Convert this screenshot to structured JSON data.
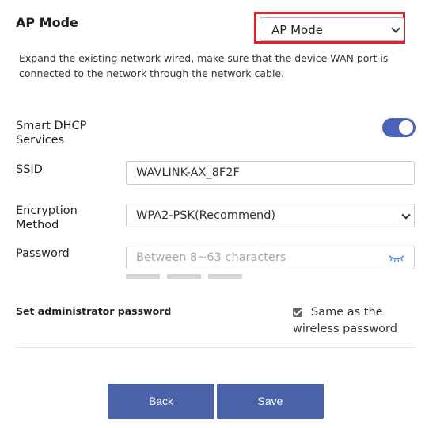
{
  "mode": {
    "title": "AP Mode",
    "selected": "AP Mode"
  },
  "description": "Expand the existing network wired, make sure that the device WAN port is connected to the network through the network cable.",
  "dhcp": {
    "label": "Smart DHCP Services",
    "enabled": true
  },
  "ssid": {
    "label": "SSID",
    "value": "WAVLINK-AX_8F2F"
  },
  "encryption": {
    "label": "Encryption Method",
    "selected": "WPA2-PSK(Recommend)"
  },
  "password": {
    "label": "Password",
    "placeholder": "Between 8~63 characters",
    "value": "",
    "icon": "eye-closed-icon"
  },
  "admin": {
    "label": "Set administrator password",
    "same_checked": true,
    "same_label": "Same as the wireless password"
  },
  "buttons": {
    "back": "Back",
    "save": "Save"
  },
  "colors": {
    "accent": "#4a63a8",
    "highlight_border": "#e0202a"
  }
}
